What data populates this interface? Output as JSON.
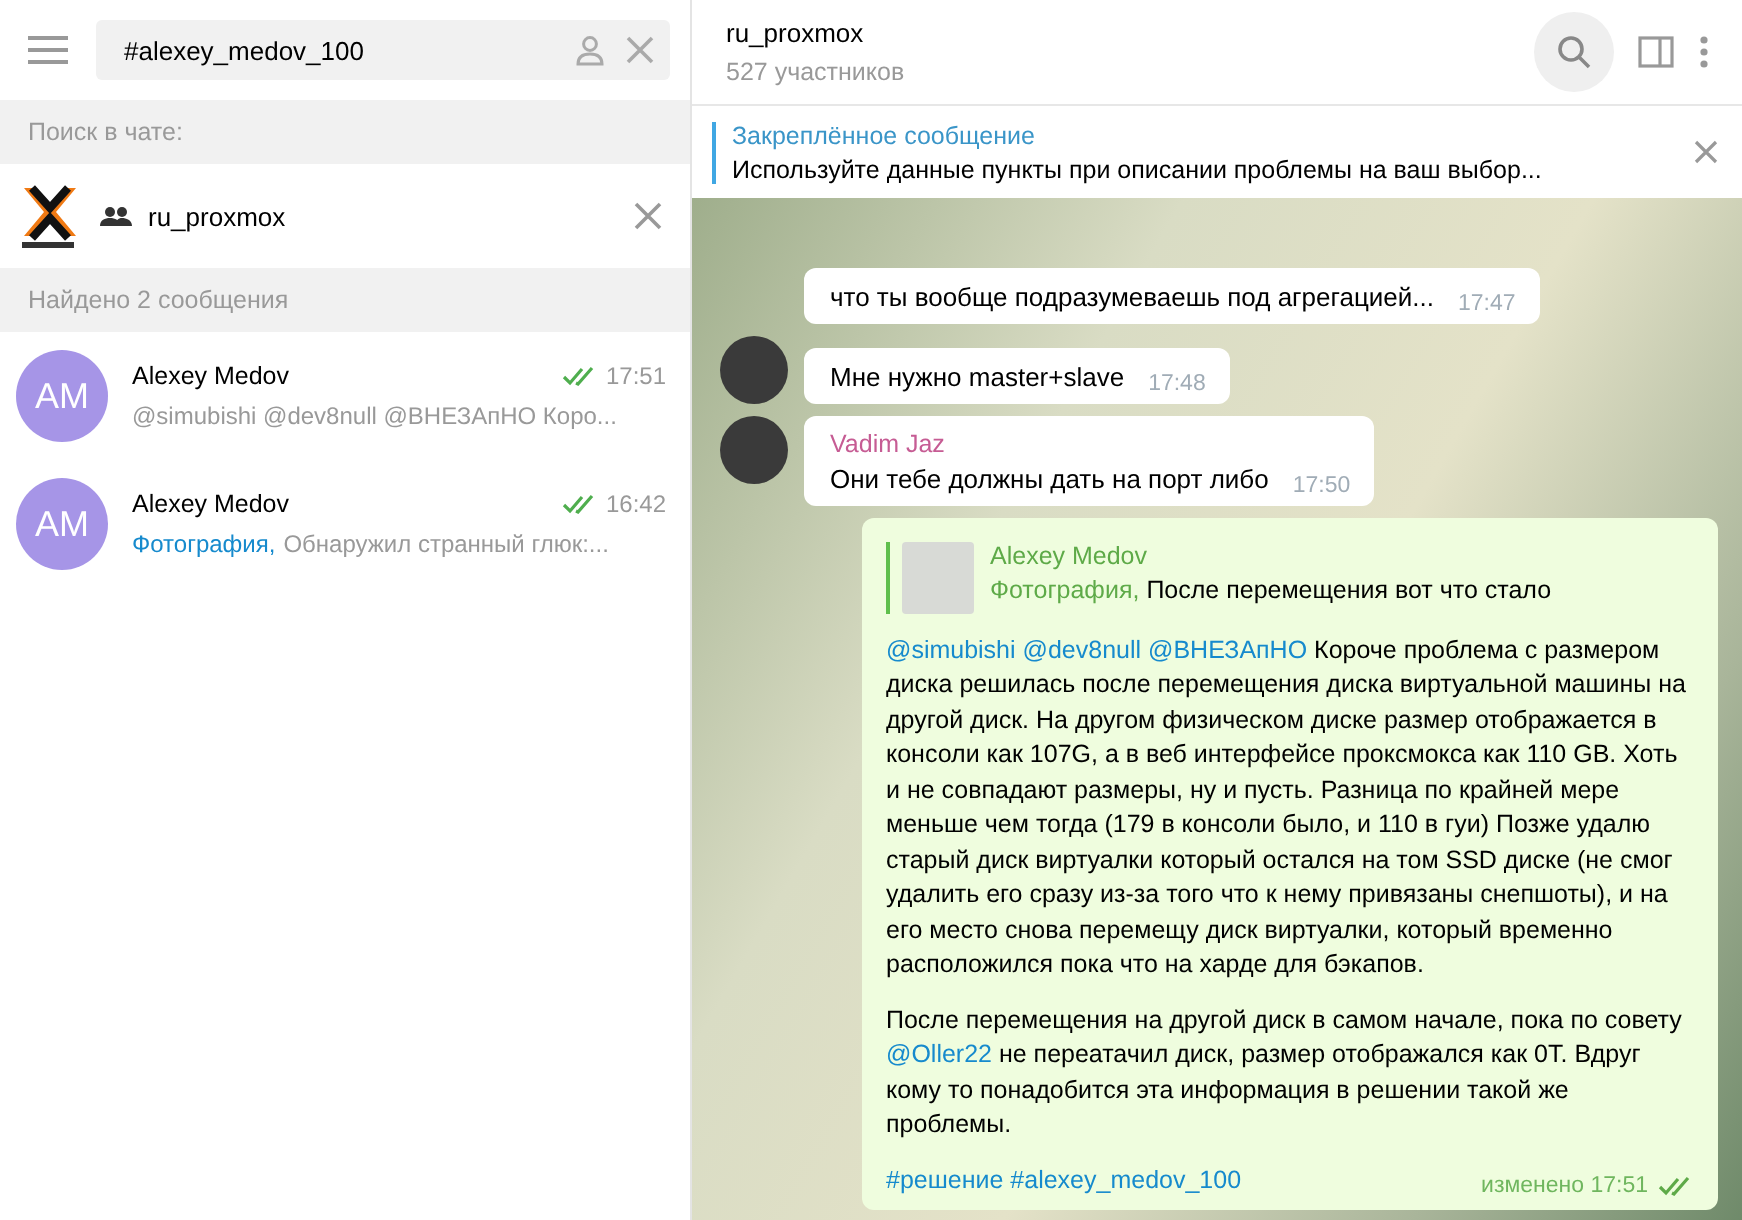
{
  "sidebar": {
    "search": {
      "value": "#alexey_medov_100"
    },
    "search_in_chat_label": "Поиск в чате:",
    "chat_filter": {
      "name": "ru_proxmox"
    },
    "results_header": "Найдено 2 сообщения",
    "results": [
      {
        "initials": "AM",
        "name": "Alexey Medov",
        "time": "17:51",
        "read": true,
        "preview": "@simubishi @dev8null @ВНЕЗАпНО Коро..."
      },
      {
        "initials": "AM",
        "name": "Alexey Medov",
        "time": "16:42",
        "read": true,
        "media": "Фотография,",
        "preview": "Обнаружил странный глюк:..."
      }
    ]
  },
  "chat": {
    "title": "ru_proxmox",
    "subtitle": "527 участников",
    "search_active": true,
    "pinned": {
      "label": "Закреплённое сообщение",
      "text": "Используйте данные пункты при описании проблемы на ваш выбор..."
    },
    "messages": [
      {
        "kind": "incoming",
        "avatar": false,
        "text": "что ты вообще подразумеваешь под агрегацией...",
        "time": "17:47"
      },
      {
        "kind": "incoming",
        "avatar": true,
        "text": "Мне нужно master+slave",
        "time": "17:48"
      },
      {
        "kind": "incoming",
        "avatar": true,
        "sender": "Vadim Jaz",
        "text": "Они тебе должны дать на порт либо",
        "time": "17:50"
      },
      {
        "kind": "outgoing",
        "sender": "Alexey Medov",
        "reply_media": "Фотография,",
        "reply_text": "После перемещения вот что стало",
        "paragraphs": [
          [
            {
              "kind": "mention",
              "text": "@simubishi"
            },
            {
              "kind": "mention",
              "text": "@dev8null"
            },
            {
              "kind": "mention",
              "text": "@ВНЕЗАпНО"
            },
            {
              "kind": "plain",
              "text": " Короче проблема с размером диска решилась после перемещения диска виртуальной машины на другой диск. На другом физическом диске размер отображается в консоли как 107G, а в веб интерфейсе проксмокса как 110 GB. Хоть и не совпадают размеры, ну и пусть. Разница по крайней мере меньше чем тогда (179 в консоли было, и 110 в гуи) Позже удалю старый диск виртуалки который остался на том SSD диске (не смог удалить его сразу из-за того что к нему привязаны снепшоты), и на его место снова перемещу диск виртуалки, который временно расположился пока что на харде для бэкапов."
            }
          ],
          [
            {
              "kind": "plain",
              "text": "После перемещения на другой диск в самом начале, пока по совету "
            },
            {
              "kind": "mention",
              "text": "@Oller22"
            },
            {
              "kind": "plain",
              "text": " не переатачил диск, размер отображался как 0Т. Вдруг кому то понадобится эта информация в решении такой же проблемы."
            }
          ],
          [
            {
              "kind": "mention",
              "text": "#решение"
            },
            {
              "kind": "mention",
              "text": "#alexey_medov_100"
            }
          ]
        ],
        "edited": "изменено 17:51",
        "read": true
      }
    ]
  }
}
